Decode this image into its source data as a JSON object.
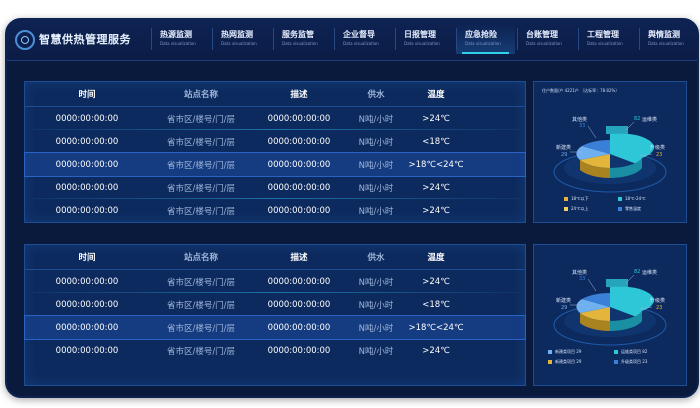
{
  "app": {
    "title": "智慧供热管理服务"
  },
  "tabs": [
    {
      "label": "热源监测",
      "sub": "Data visualization"
    },
    {
      "label": "热网监测",
      "sub": "Data visualization"
    },
    {
      "label": "服务监管",
      "sub": "Data visualization"
    },
    {
      "label": "企业督导",
      "sub": "Data visualization"
    },
    {
      "label": "日报管理",
      "sub": "Data visualization"
    },
    {
      "label": "应急抢险",
      "sub": "Data visualization"
    },
    {
      "label": "台账管理",
      "sub": "Data visualization"
    },
    {
      "label": "工程管理",
      "sub": "Data visualization"
    },
    {
      "label": "舆情监测",
      "sub": "Data visualization"
    }
  ],
  "active_tab": "应急抢险",
  "table1": {
    "headers": [
      "时间",
      "站点名称",
      "描述",
      "供水",
      "温度"
    ],
    "rows": [
      [
        "0000:00:00:00",
        "省市区/楼号/门/层",
        "0000:00:00:00",
        "N吨/小时",
        ">24℃"
      ],
      [
        "0000:00:00:00",
        "省市区/楼号/门/层",
        "0000:00:00:00",
        "N吨/小时",
        "<18℃"
      ],
      [
        "0000:00:00:00",
        "省市区/楼号/门/层",
        "0000:00:00:00",
        "N吨/小时",
        ">18℃<24℃"
      ],
      [
        "0000:00:00:00",
        "省市区/楼号/门/层",
        "0000:00:00:00",
        "N吨/小时",
        ">24℃"
      ],
      [
        "0000:00:00:00",
        "省市区/楼号/门/层",
        "0000:00:00:00",
        "N吨/小时",
        ">24℃"
      ]
    ]
  },
  "table2": {
    "headers": [
      "时间",
      "站点名称",
      "描述",
      "供水",
      "温度"
    ],
    "rows": [
      [
        "0000:00:00:00",
        "省市区/楼号/门/层",
        "0000:00:00:00",
        "N吨/小时",
        ">24℃"
      ],
      [
        "0000:00:00:00",
        "省市区/楼号/门/层",
        "0000:00:00:00",
        "N吨/小时",
        "<18℃"
      ],
      [
        "0000:00:00:00",
        "省市区/楼号/门/层",
        "0000:00:00:00",
        "N吨/小时",
        ">18℃<24℃"
      ],
      [
        "0000:00:00:00",
        "省市区/楼号/门/层",
        "0000:00:00:00",
        "N吨/小时",
        ">24℃"
      ]
    ]
  },
  "chart1": {
    "title": "住户数量/户 4221户 （达标率：78.82%）",
    "slices": [
      {
        "label": "其他类",
        "value": "33",
        "color": "#3a7fd8"
      },
      {
        "label": "运维类",
        "value": "82",
        "color": "#2ec7d8"
      },
      {
        "label": "新建类",
        "value": "29",
        "color": "#6fb0f0"
      },
      {
        "label": "升级类",
        "value": "23",
        "color": "#e3b53a"
      }
    ],
    "legend": [
      {
        "label": "18℃以下",
        "color": "#e3b53a"
      },
      {
        "label": "18℃-24℃",
        "color": "#2ec7d8"
      },
      {
        "label": "24℃以上",
        "color": "#f0d060"
      },
      {
        "label": "零售温度",
        "color": "#3a7fd8"
      }
    ]
  },
  "chart2": {
    "slices": [
      {
        "label": "其他类",
        "value": "33",
        "color": "#3a7fd8"
      },
      {
        "label": "运维类",
        "value": "82",
        "color": "#2ec7d8"
      },
      {
        "label": "新建类",
        "value": "29",
        "color": "#6fb0f0"
      },
      {
        "label": "升级类",
        "value": "23",
        "color": "#e3b53a"
      }
    ],
    "legend": [
      {
        "label": "新建类项目",
        "value": "29",
        "color": "#6fb0f0"
      },
      {
        "label": "运维类项目",
        "value": "82",
        "color": "#2ec7d8"
      },
      {
        "label": "新建类项目",
        "value": "29",
        "color": "#e3b53a"
      },
      {
        "label": "升级类项目",
        "value": "23",
        "color": "#3a7fd8"
      }
    ]
  }
}
